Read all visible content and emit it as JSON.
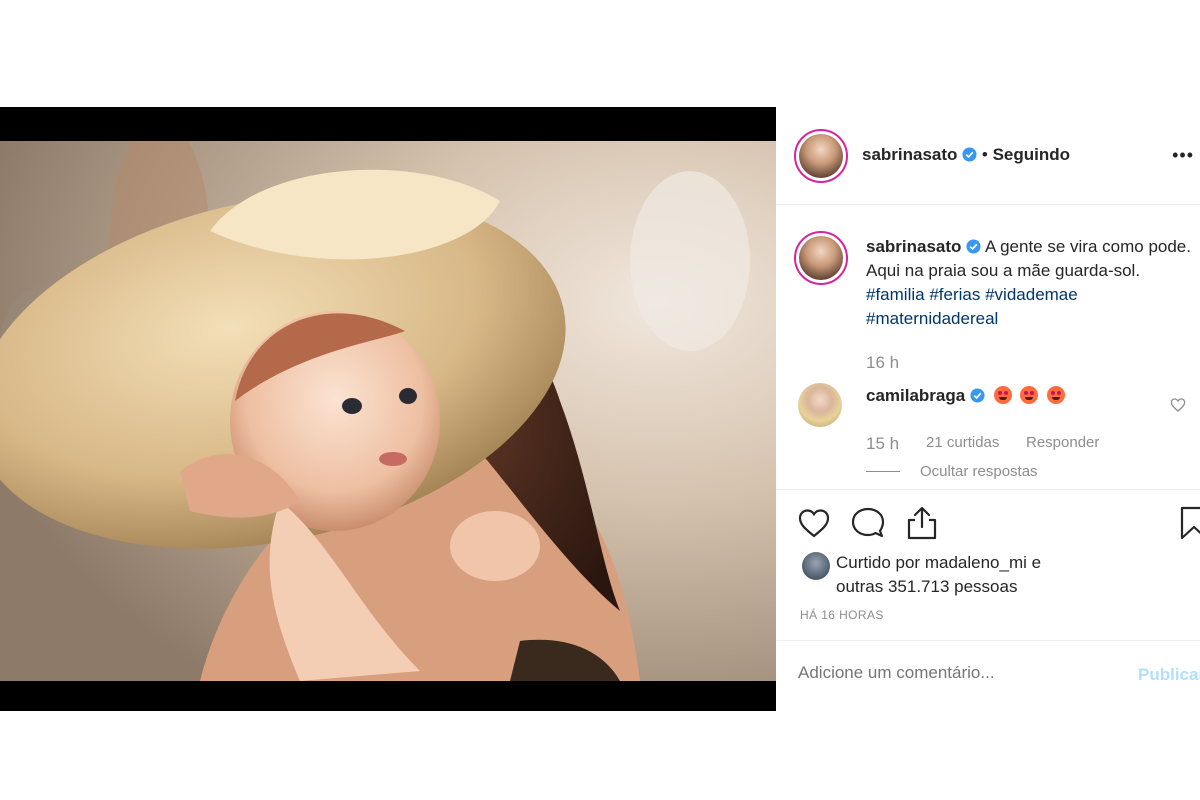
{
  "post": {
    "author": "sabrinasato",
    "follow_separator": "•",
    "follow_status": "Seguindo",
    "more_options": "•••",
    "caption_text": "A gente se vira como pode. Aqui na praia sou a mãe guarda-sol.",
    "hashtags": [
      "#familia",
      "#ferias",
      "#vidademae",
      "#maternidadereal"
    ],
    "caption_time": "16 h",
    "verified_color": "#3897f0"
  },
  "comment": {
    "author": "camilabraga",
    "emoji": [
      "heart-eyes",
      "heart-eyes",
      "heart-eyes"
    ],
    "time": "15 h",
    "likes": "21 curtidas",
    "reply": "Responder",
    "hide_replies": "Ocultar respostas"
  },
  "actions": {
    "icons": [
      "heart-icon",
      "comment-icon",
      "share-icon",
      "bookmark-icon"
    ]
  },
  "likes": {
    "prefix": "Curtido por",
    "user": "madaleno_mi",
    "conjunction": "e",
    "others": "outras 351.713 pessoas"
  },
  "timestamp": "HÁ 16 HORAS",
  "comment_box": {
    "placeholder": "Adicione um comentário...",
    "publish": "Publicar"
  }
}
